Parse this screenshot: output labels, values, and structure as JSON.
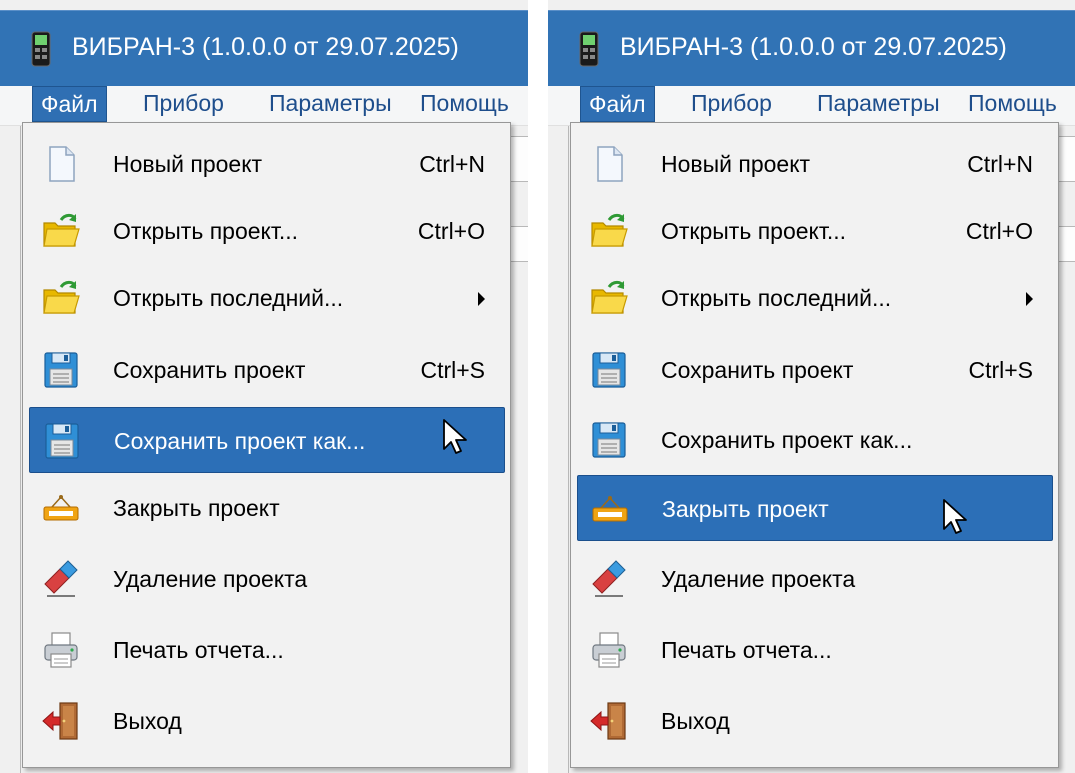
{
  "window": {
    "title": "ВИБРАН-3 (1.0.0.0 от 29.07.2025)"
  },
  "menubar": {
    "file": "Файл",
    "device": "Прибор",
    "params": "Параметры",
    "help": "Помощь"
  },
  "file_menu": {
    "items": [
      {
        "label": "Новый проект",
        "shortcut": "Ctrl+N",
        "icon": "new-document-icon"
      },
      {
        "label": "Открыть проект...",
        "shortcut": "Ctrl+O",
        "icon": "open-folder-icon"
      },
      {
        "label": "Открыть последний...",
        "shortcut": "",
        "icon": "open-folder-icon",
        "has_submenu": true
      },
      {
        "label": "Сохранить проект",
        "shortcut": "Ctrl+S",
        "icon": "save-disk-icon"
      },
      {
        "label": "Сохранить проект как...",
        "shortcut": "",
        "icon": "save-disk-icon"
      },
      {
        "label": "Закрыть проект",
        "shortcut": "",
        "icon": "close-sign-icon"
      },
      {
        "label": "Удаление проекта",
        "shortcut": "",
        "icon": "eraser-icon"
      },
      {
        "label": "Печать отчета...",
        "shortcut": "",
        "icon": "printer-icon"
      },
      {
        "label": "Выход",
        "shortcut": "",
        "icon": "exit-door-icon"
      }
    ]
  },
  "panels": [
    {
      "highlighted_item": "Сохранить проект как..."
    },
    {
      "highlighted_item": "Закрыть проект"
    }
  ],
  "colors": {
    "titlebar": "#3173b5",
    "highlight": "#2c6fb7",
    "menu_background": "#f2f2f2",
    "menubar_text": "#1e4e8c"
  }
}
